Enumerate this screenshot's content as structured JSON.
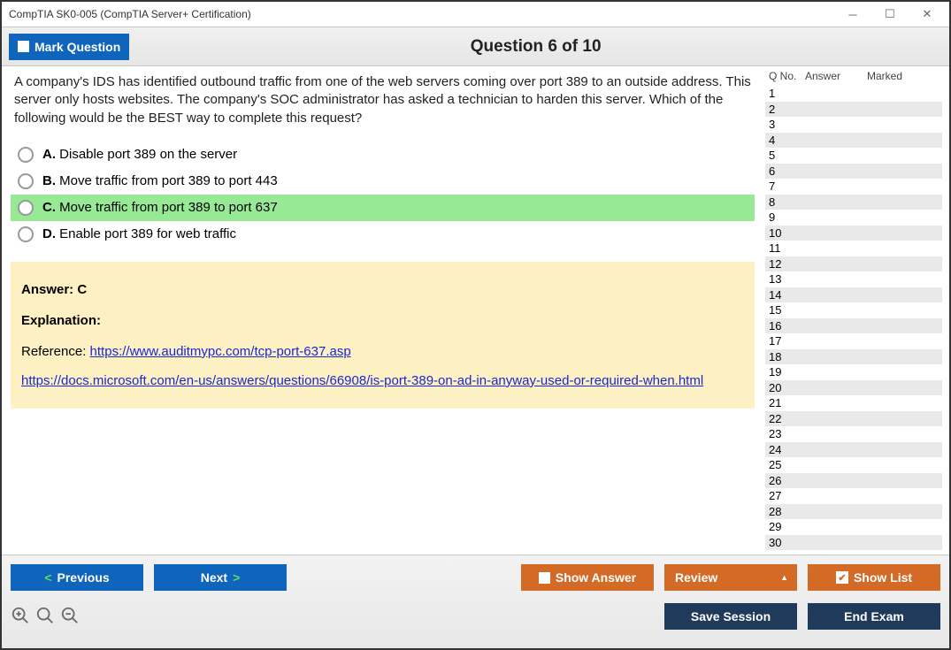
{
  "window": {
    "title": "CompTIA SK0-005 (CompTIA Server+ Certification)"
  },
  "toolbar": {
    "mark_label": "Mark Question",
    "question_counter": "Question 6 of 10"
  },
  "question": {
    "text": "A company's IDS has identified outbound traffic from one of the web servers coming over port 389 to an outside address. This server only hosts websites. The company's SOC administrator has asked a technician to harden this server. Which of the following would be the BEST way to complete this request?",
    "choices": [
      {
        "letter": "A.",
        "text": "Disable port 389 on the server",
        "selected": false
      },
      {
        "letter": "B.",
        "text": "Move traffic from port 389 to port 443",
        "selected": false
      },
      {
        "letter": "C.",
        "text": "Move traffic from port 389 to port 637",
        "selected": true
      },
      {
        "letter": "D.",
        "text": "Enable port 389 for web traffic",
        "selected": false
      }
    ]
  },
  "answer": {
    "heading": "Answer: C",
    "explanation_label": "Explanation:",
    "reference_label": "Reference: ",
    "link1": "https://www.auditmypc.com/tcp-port-637.asp",
    "link2": "https://docs.microsoft.com/en-us/answers/questions/66908/is-port-389-on-ad-in-anyway-used-or-required-when.html"
  },
  "sidebar": {
    "col_qno": "Q No.",
    "col_answer": "Answer",
    "col_marked": "Marked",
    "rows": [
      1,
      2,
      3,
      4,
      5,
      6,
      7,
      8,
      9,
      10,
      11,
      12,
      13,
      14,
      15,
      16,
      17,
      18,
      19,
      20,
      21,
      22,
      23,
      24,
      25,
      26,
      27,
      28,
      29,
      30
    ]
  },
  "footer": {
    "prev": "Previous",
    "next": "Next",
    "show_answer": "Show Answer",
    "review": "Review",
    "show_list": "Show List",
    "save_session": "Save Session",
    "end_exam": "End Exam"
  }
}
